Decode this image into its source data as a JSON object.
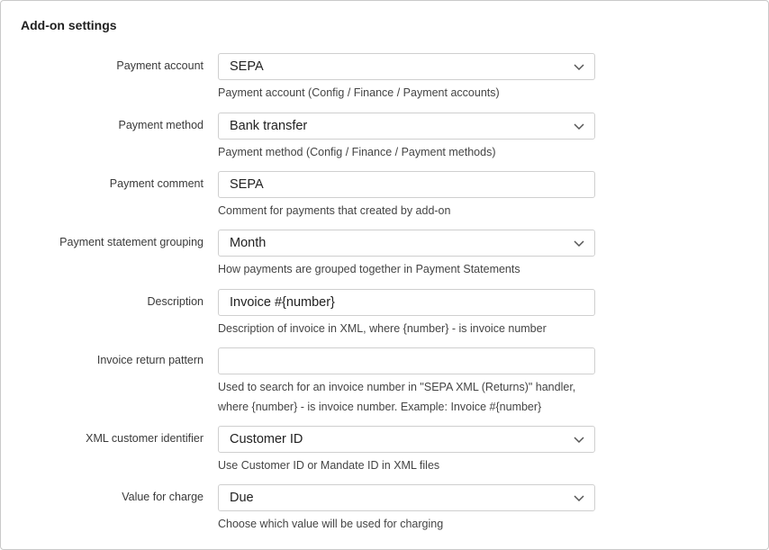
{
  "section": {
    "title": "Add-on settings"
  },
  "fields": [
    {
      "label": "Payment account",
      "value": "SEPA",
      "type": "select",
      "help": "Payment account (Config / Finance / Payment accounts)"
    },
    {
      "label": "Payment method",
      "value": "Bank transfer",
      "type": "select",
      "help": "Payment method (Config / Finance / Payment methods)"
    },
    {
      "label": "Payment comment",
      "value": "SEPA",
      "type": "text",
      "help": "Comment for payments that created by add-on"
    },
    {
      "label": "Payment statement grouping",
      "value": "Month",
      "type": "select",
      "help": "How payments are grouped together in Payment Statements"
    },
    {
      "label": "Description",
      "value": "Invoice #{number}",
      "type": "text",
      "help": "Description of invoice in XML, where {number} - is invoice number"
    },
    {
      "label": "Invoice return pattern",
      "value": "",
      "type": "text",
      "help": "Used to search for an invoice number in \"SEPA XML (Returns)\" handler, where {number} - is invoice number. Example: Invoice #{number}"
    },
    {
      "label": "XML customer identifier",
      "value": "Customer ID",
      "type": "select",
      "help": "Use Customer ID or Mandate ID in XML files"
    },
    {
      "label": "Value for charge",
      "value": "Due",
      "type": "select",
      "help": "Choose which value will be used for charging"
    }
  ],
  "icons": {
    "select_arrow": "chevron-down-icon"
  },
  "colors": {
    "border": "#cfcfcf",
    "text": "#222222",
    "help_text": "#444444"
  }
}
